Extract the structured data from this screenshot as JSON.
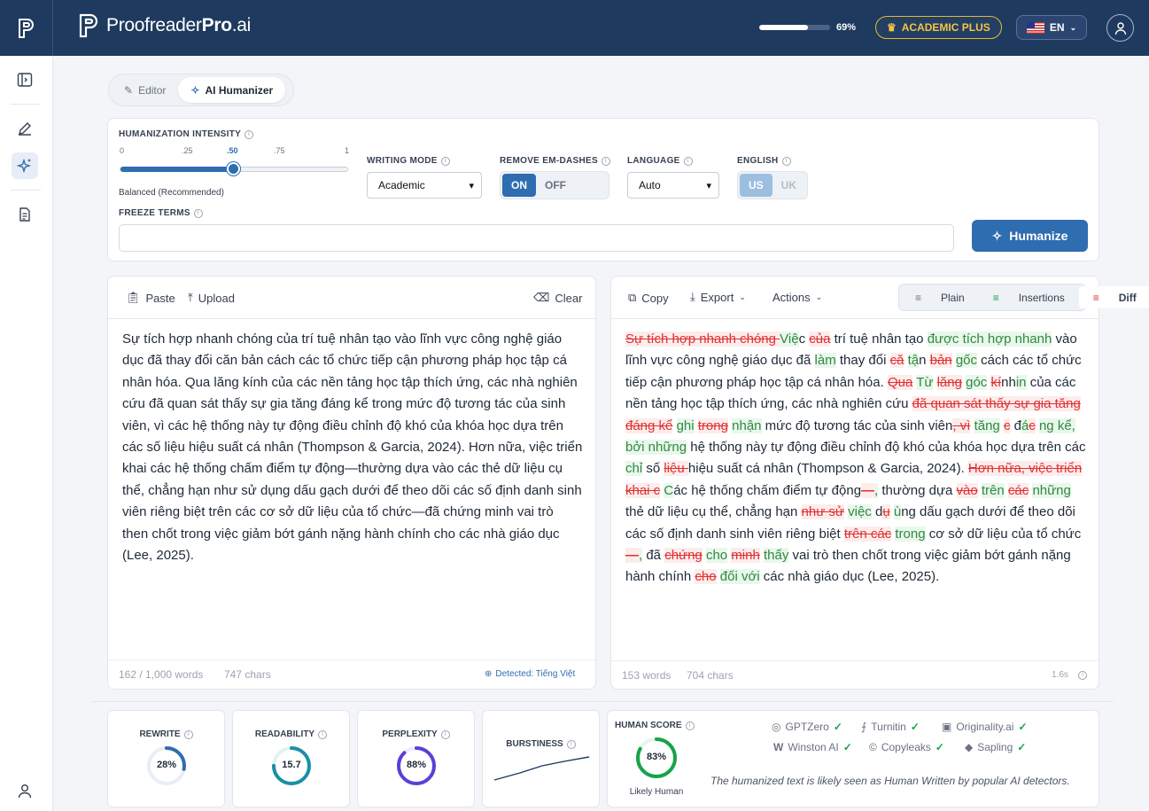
{
  "brand": {
    "name_regular": "Proofreader",
    "name_bold": "Pro",
    "name_suffix": ".ai"
  },
  "usage": {
    "percent_label": "69%",
    "fraction": 0.69
  },
  "plan_label": "ACADEMIC PLUS",
  "language_selector": {
    "label": "EN"
  },
  "mode_tabs": [
    {
      "label": "Editor"
    },
    {
      "label": "AI Humanizer"
    }
  ],
  "settings": {
    "intensity": {
      "label": "HUMANIZATION INTENSITY",
      "ticks": [
        "0",
        ".25",
        ".50",
        ".75",
        "1"
      ],
      "value": 0.5,
      "caption": "Balanced (Recommended)"
    },
    "writing_mode": {
      "label": "WRITING MODE",
      "value": "Academic"
    },
    "remove_em_dashes": {
      "label": "REMOVE EM-DASHES",
      "on": "ON",
      "off": "OFF"
    },
    "language": {
      "label": "LANGUAGE",
      "value": "Auto"
    },
    "english": {
      "label": "ENGLISH",
      "us": "US",
      "uk": "UK"
    },
    "freeze_terms": {
      "label": "FREEZE TERMS",
      "value": ""
    },
    "humanize_label": "Humanize"
  },
  "input_pane": {
    "paste": "Paste",
    "upload": "Upload",
    "clear": "Clear",
    "text": "Sự tích hợp nhanh chóng của trí tuệ nhân tạo vào lĩnh vực công nghệ giáo dục đã thay đổi căn bản cách các tổ chức tiếp cận phương pháp học tập cá nhân hóa. Qua lăng kính của các nền tảng học tập thích ứng, các nhà nghiên cứu đã quan sát thấy sự gia tăng đáng kể trong mức độ tương tác của sinh viên, vì các hệ thống này tự động điều chỉnh độ khó của khóa học dựa trên các số liệu hiệu suất cá nhân (Thompson & Garcia, 2024). Hơn nữa, việc triển khai các hệ thống chấm điểm tự động—thường dựa vào các thẻ dữ liệu cụ thể, chẳng hạn như sử dụng dấu gạch dưới để theo dõi các số định danh sinh viên riêng biệt trên các cơ sở dữ liệu của tổ chức—đã chứng minh vai trò then chốt trong việc giảm bớt gánh nặng hành chính cho các nhà giáo dục (Lee, 2025).",
    "word_count": "162 / 1,000 words",
    "char_count": "747 chars",
    "detected": "Detected: Tiếng Việt"
  },
  "output_pane": {
    "copy": "Copy",
    "export": "Export",
    "actions": "Actions",
    "views": [
      "Plain",
      "Insertions",
      "Diff"
    ],
    "word_count": "153 words",
    "char_count": "704 chars",
    "time": "1.6s",
    "diff": [
      [
        "d",
        "Sự tích hợp nhanh chóng "
      ],
      [
        "i",
        "Việ"
      ],
      [
        "n",
        "c "
      ],
      [
        "d",
        "của"
      ],
      [
        "n",
        " trí tuệ nhân tạo "
      ],
      [
        "i",
        "được tích hợp nhanh"
      ],
      [
        "n",
        " vào lĩnh vực công nghệ giáo dục đã "
      ],
      [
        "i",
        "làm"
      ],
      [
        "n",
        " thay đổi "
      ],
      [
        "d",
        "că"
      ],
      [
        "n",
        " "
      ],
      [
        "i",
        "tậ"
      ],
      [
        "n",
        "n "
      ],
      [
        "d",
        "bản"
      ],
      [
        "n",
        " "
      ],
      [
        "i",
        "gốc"
      ],
      [
        "n",
        " cách các tổ chức tiếp cận phương pháp học tập cá nhân hóa. "
      ],
      [
        "d",
        "Qua"
      ],
      [
        "n",
        " "
      ],
      [
        "i",
        "Từ"
      ],
      [
        "n",
        " "
      ],
      [
        "d",
        "lăng"
      ],
      [
        "n",
        " "
      ],
      [
        "i",
        "góc"
      ],
      [
        "n",
        " "
      ],
      [
        "d",
        "kí"
      ],
      [
        "n",
        "nh"
      ],
      [
        "i",
        "in"
      ],
      [
        "n",
        " của các nền tảng học tập thích ứng, các nhà nghiên cứu "
      ],
      [
        "d",
        "đã quan sát thấy sự gia tăng đáng kể"
      ],
      [
        "n",
        " "
      ],
      [
        "i",
        "ghi"
      ],
      [
        "n",
        " "
      ],
      [
        "d",
        "trong"
      ],
      [
        "n",
        " "
      ],
      [
        "i",
        "nhận"
      ],
      [
        "n",
        " mức độ tương tác của sinh viên"
      ],
      [
        "d",
        ", vì"
      ],
      [
        "n",
        " "
      ],
      [
        "i",
        "tăng"
      ],
      [
        "n",
        " "
      ],
      [
        "d",
        "c"
      ],
      [
        "n",
        " đ"
      ],
      [
        "i",
        "á"
      ],
      [
        "d",
        "c"
      ],
      [
        "n",
        " "
      ],
      [
        "i",
        "ng kể, bởi những"
      ],
      [
        "n",
        " hệ thống này tự động điều chỉnh độ khó của khóa học dựa trên các "
      ],
      [
        "i",
        "chỉ"
      ],
      [
        "n",
        " số "
      ],
      [
        "d",
        "liệu "
      ],
      [
        "n",
        "hiệu suất cá nhân (Thompson & Garcia, 2024). "
      ],
      [
        "d",
        "Hơn nữa, việc triển khai c"
      ],
      [
        "n",
        " "
      ],
      [
        "i",
        "C"
      ],
      [
        "n",
        "ác hệ thống chấm điểm tự động"
      ],
      [
        "d",
        "—"
      ],
      [
        "i",
        ","
      ],
      [
        "n",
        " thường dựa "
      ],
      [
        "d",
        "vào"
      ],
      [
        "n",
        " "
      ],
      [
        "i",
        "trên"
      ],
      [
        "n",
        " "
      ],
      [
        "d",
        "các"
      ],
      [
        "n",
        " "
      ],
      [
        "i",
        "những"
      ],
      [
        "n",
        " thẻ dữ liệu cụ thể, chẳng hạn "
      ],
      [
        "d",
        "như sử"
      ],
      [
        "n",
        " "
      ],
      [
        "i",
        "việc"
      ],
      [
        "n",
        " d"
      ],
      [
        "d",
        "ụ"
      ],
      [
        "n",
        " "
      ],
      [
        "i",
        "ù"
      ],
      [
        "n",
        "ng dấu gạch dưới để theo dõi các số định danh sinh viên riêng biệt "
      ],
      [
        "d",
        "trên các"
      ],
      [
        "n",
        " "
      ],
      [
        "i",
        "trong"
      ],
      [
        "n",
        " cơ sở dữ liệu của tổ chức"
      ],
      [
        "d",
        "—"
      ],
      [
        "i",
        ","
      ],
      [
        "n",
        " đã "
      ],
      [
        "d",
        "chứng"
      ],
      [
        "n",
        " "
      ],
      [
        "i",
        "cho"
      ],
      [
        "n",
        " "
      ],
      [
        "d",
        "minh"
      ],
      [
        "n",
        " "
      ],
      [
        "i",
        "thấy"
      ],
      [
        "n",
        " vai trò then chốt trong việc giảm bớt gánh nặng hành chính "
      ],
      [
        "d",
        "cho"
      ],
      [
        "n",
        " "
      ],
      [
        "i",
        "đối với"
      ],
      [
        "n",
        " các nhà giáo dục (Lee, 2025)."
      ]
    ]
  },
  "metrics": {
    "rewrite": {
      "label": "REWRITE",
      "value": 28,
      "display": "28%",
      "color": "#2f6db1"
    },
    "readability": {
      "label": "READABILITY",
      "value": 15.7,
      "display": "15.7",
      "fraction": 0.75,
      "color": "#1b8fa6"
    },
    "perplexity": {
      "label": "PERPLEXITY",
      "value": 88,
      "display": "88%",
      "color": "#5b3fd6"
    },
    "burstiness": {
      "label": "BURSTINESS"
    },
    "human_score": {
      "label": "HUMAN SCORE",
      "value": 83,
      "display": "83%",
      "caption": "Likely Human",
      "color": "#16a34a"
    }
  },
  "detectors": [
    {
      "name": "GPTZero",
      "icon": "gptzero-icon"
    },
    {
      "name": "Turnitin",
      "icon": "turnitin-icon"
    },
    {
      "name": "Originality.ai",
      "icon": "originality-icon"
    },
    {
      "name": "Winston AI",
      "icon": "winston-icon"
    },
    {
      "name": "Copyleaks",
      "icon": "copyleaks-icon"
    },
    {
      "name": "Sapling",
      "icon": "sapling-icon"
    }
  ],
  "detector_note": "The humanized text is likely seen as Human Written by popular AI detectors."
}
